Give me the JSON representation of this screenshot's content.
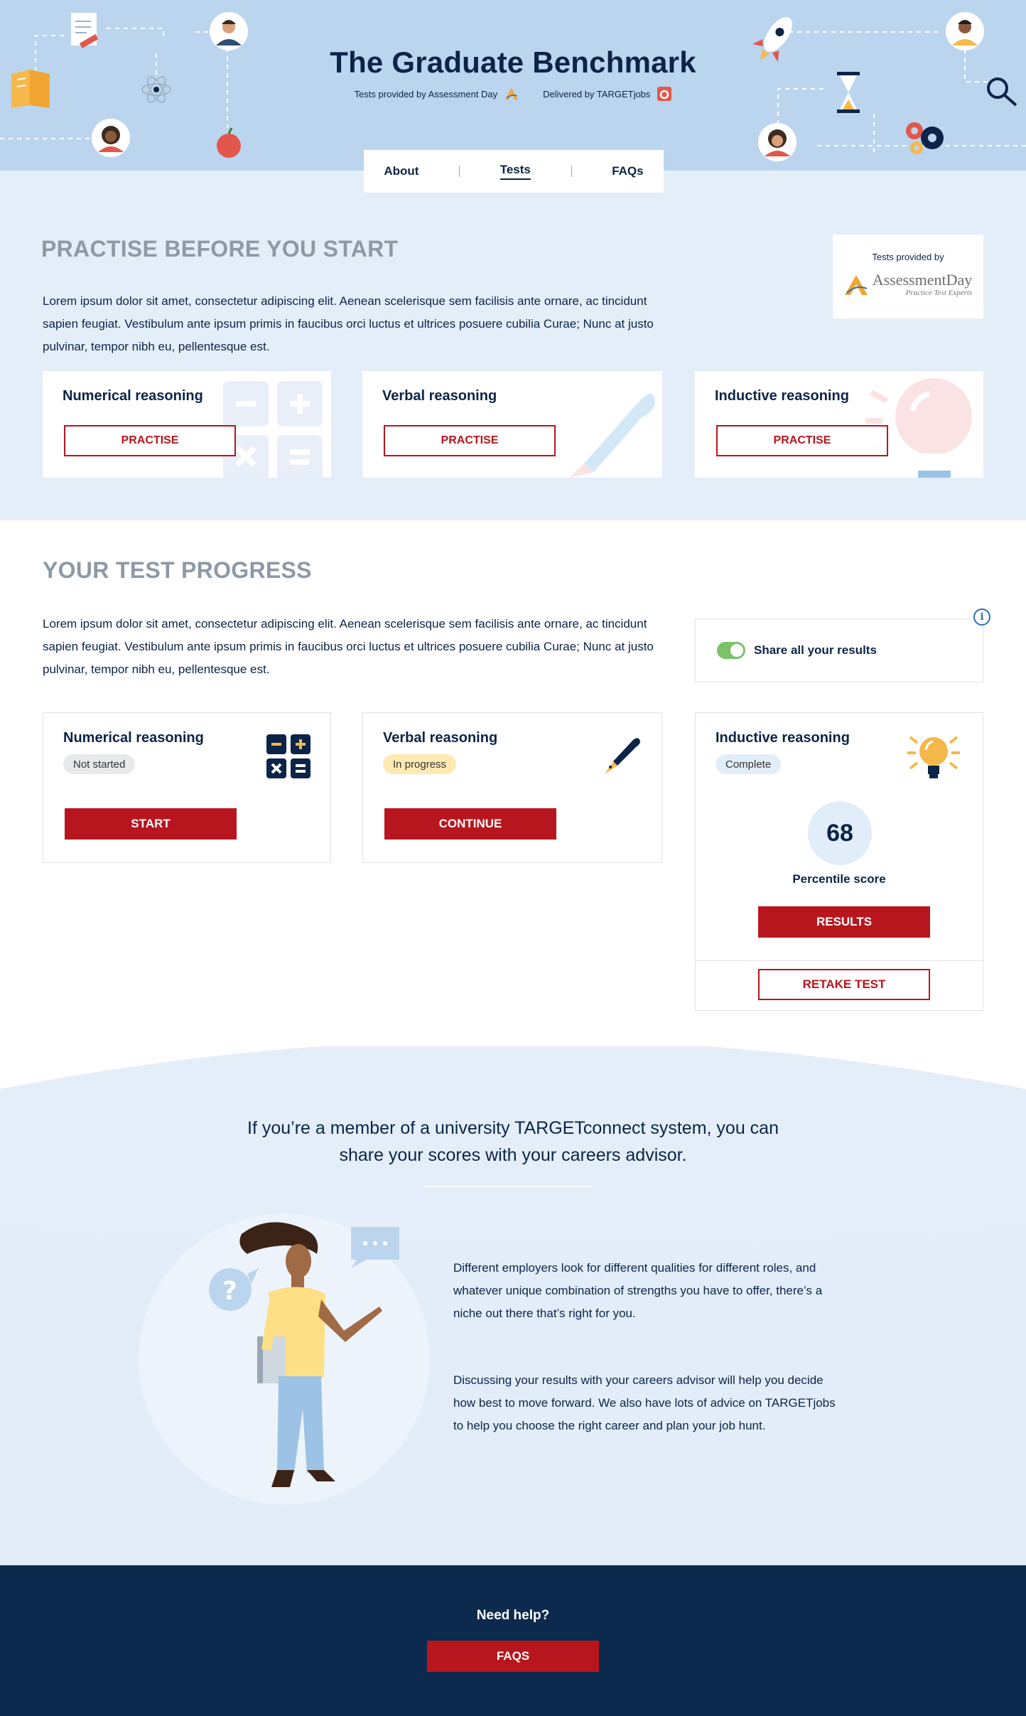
{
  "header": {
    "title": "The Graduate Benchmark",
    "tests_provided_by": "Tests provided by Assessment Day",
    "delivered_by": "Delivered by TARGETjobs"
  },
  "nav": {
    "items": [
      {
        "label": "About"
      },
      {
        "label": "Tests",
        "active": true
      },
      {
        "label": "FAQs"
      }
    ]
  },
  "practise": {
    "title": "PRACTISE BEFORE YOU START",
    "body": "Lorem ipsum dolor sit amet, consectetur adipiscing elit. Aenean scelerisque sem facilisis ante ornare, ac tincidunt sapien feugiat. Vestibulum ante ipsum primis in faucibus orci luctus et ultrices posuere cubilia Curae; Nunc at justo pulvinar, tempor nibh eu, pellentesque est.",
    "provider_label": "Tests provided by",
    "provider_name": "AssessmentDay",
    "provider_tagline": "Practice Test Experts",
    "cards": [
      {
        "title": "Numerical reasoning",
        "button": "PRACTISE",
        "icon": "calculator-icon"
      },
      {
        "title": "Verbal reasoning",
        "button": "PRACTISE",
        "icon": "pen-icon"
      },
      {
        "title": "Inductive reasoning",
        "button": "PRACTISE",
        "icon": "lightbulb-icon"
      }
    ]
  },
  "progress": {
    "title": "YOUR TEST PROGRESS",
    "body": "Lorem ipsum dolor sit amet, consectetur adipiscing elit. Aenean scelerisque sem facilisis ante ornare, ac tincidunt sapien feugiat. Vestibulum ante ipsum primis in faucibus orci luctus et ultrices posuere cubilia Curae; Nunc at justo pulvinar, tempor nibh eu, pellentesque est.",
    "share_label": "Share all your results",
    "share_enabled": true,
    "info_symbol": "i",
    "cards": [
      {
        "title": "Numerical reasoning",
        "status": "Not started",
        "button": "START",
        "icon": "calculator-icon"
      },
      {
        "title": "Verbal reasoning",
        "status": "In progress",
        "button": "CONTINUE",
        "icon": "pen-icon"
      },
      {
        "title": "Inductive reasoning",
        "status": "Complete",
        "score": "68",
        "score_label": "Percentile score",
        "button": "RESULTS",
        "secondary_button": "RETAKE TEST",
        "icon": "lightbulb-icon"
      }
    ]
  },
  "connect": {
    "headline": "If you’re a member of a university TARGETconnect system, you can share your scores with your careers advisor.",
    "paragraph1": "Different employers look for different qualities for different roles, and whatever unique combination of strengths you have to offer, there’s a niche out there that’s right for you.",
    "paragraph2": "Discussing your results with your careers advisor will help you decide how best to move forward. We also have lots of advice on TARGETjobs to help you choose the right career and plan your job hunt."
  },
  "footer": {
    "help": "Need help?",
    "button": "FAQS"
  },
  "colors": {
    "navy": "#0b2447",
    "brand_red": "#b8161e",
    "hero_blue": "#bcd5ee",
    "section_blue": "#e4eef9",
    "toggle_green": "#7bc26b",
    "footer_navy": "#0c2a4d"
  }
}
